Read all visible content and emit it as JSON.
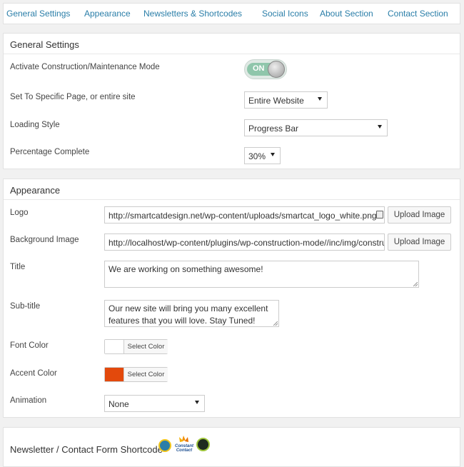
{
  "tabs": [
    "General Settings",
    "Appearance",
    "Newsletters & Shortcodes",
    "Social Icons",
    "About Section",
    "Contact Section"
  ],
  "general": {
    "heading": "General Settings",
    "maintenance_label": "Activate Construction/Maintenance Mode",
    "toggle_text": "ON",
    "scope_label": "Set To Specific Page, or entire site",
    "scope_value": "Entire Website",
    "loading_label": "Loading Style",
    "loading_value": "Progress Bar",
    "percentage_label": "Percentage Complete",
    "percentage_value": "30%"
  },
  "appearance": {
    "heading": "Appearance",
    "logo_label": "Logo",
    "logo_value": "http://smartcatdesign.net/wp-content/uploads/smartcat_logo_white.png",
    "bg_label": "Background Image",
    "bg_value": "http://localhost/wp-content/plugins/wp-construction-mode//inc/img/construction.jpg",
    "upload_label": "Upload Image",
    "title_label": "Title",
    "title_value": "We are working on something awesome!",
    "subtitle_label": "Sub-title",
    "subtitle_value": "Our new site will bring you many excellent features that you will love. Stay Tuned!",
    "font_color_label": "Font Color",
    "accent_color_label": "Accent Color",
    "select_color_label": "Select Color",
    "font_color": "#ffffff",
    "accent_color": "#e3490c",
    "animation_label": "Animation",
    "animation_value": "None"
  },
  "newsletter": {
    "heading": "Newsletter / Contact Form Shortcode",
    "logo_caption": "Constant Contact"
  }
}
